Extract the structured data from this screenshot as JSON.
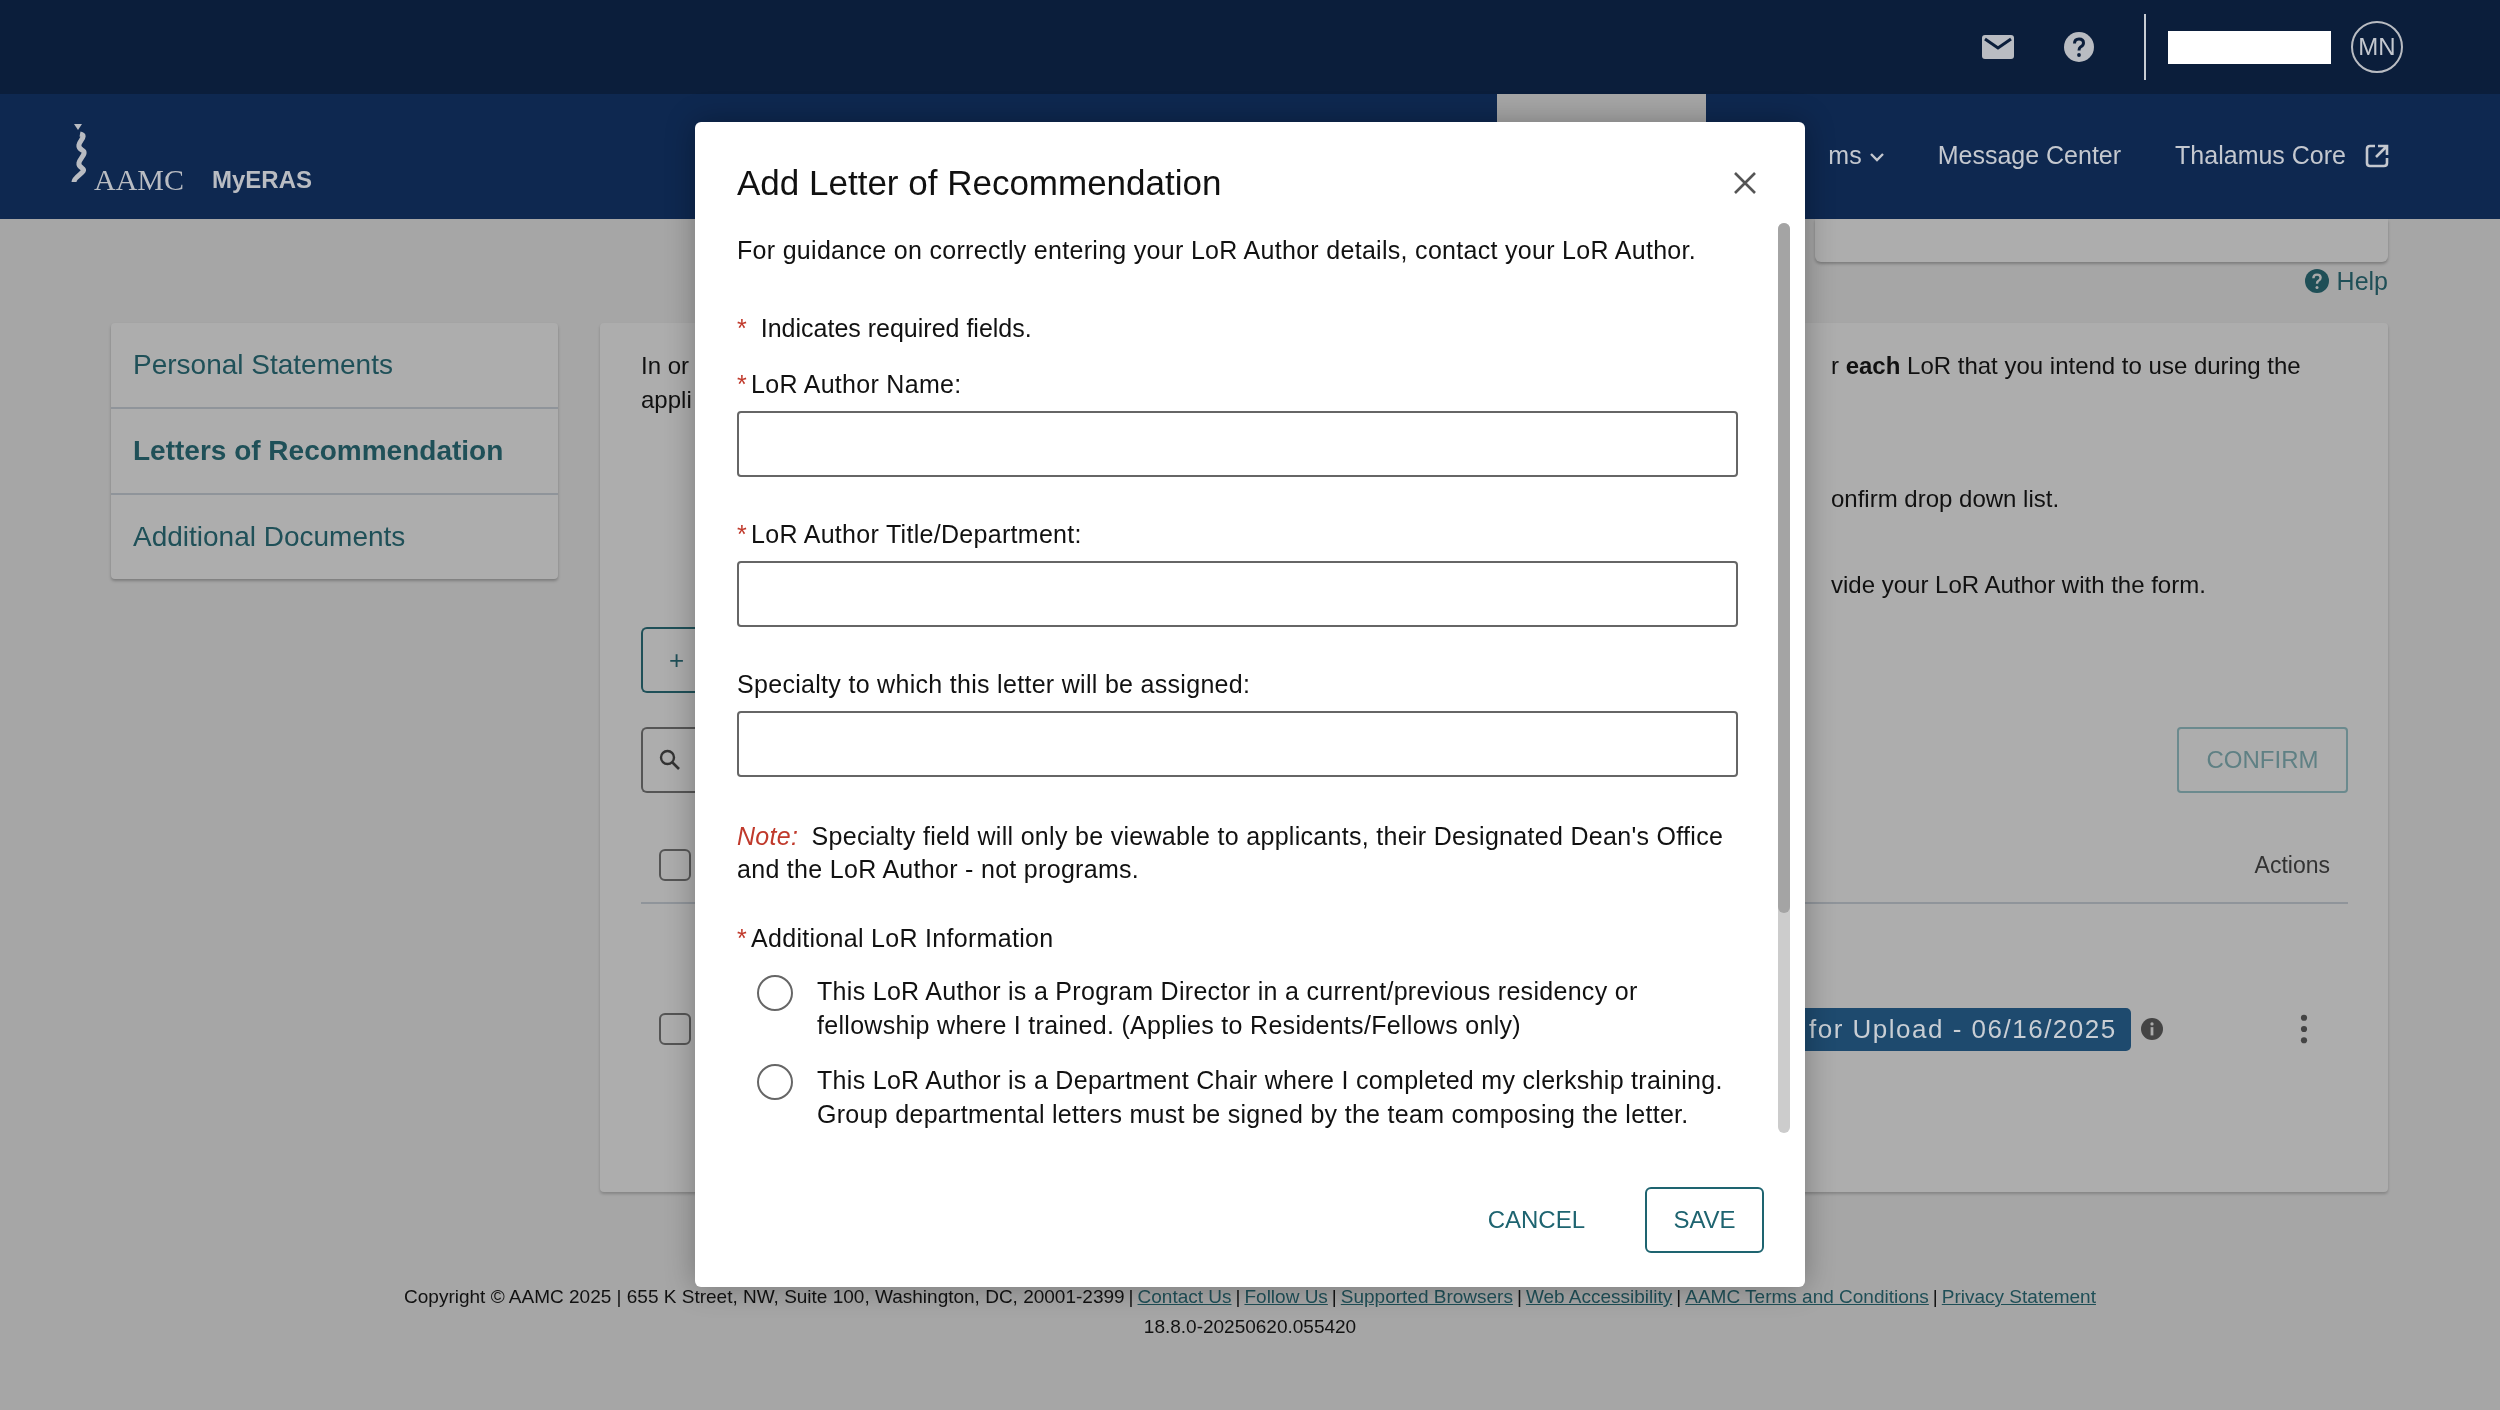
{
  "top_bar": {
    "avatar": "MN"
  },
  "nav": {
    "brand": "AAMC",
    "app": "MyERAS",
    "items": [
      {
        "label": "ms",
        "kind": "dropdown"
      },
      {
        "label": "Message Center",
        "kind": "link"
      },
      {
        "label": "Thalamus Core",
        "kind": "external"
      }
    ]
  },
  "help": "Help",
  "sidebar": {
    "items": [
      {
        "label": "Personal Statements",
        "selected": false
      },
      {
        "label": "Letters of Recommendation",
        "selected": true
      },
      {
        "label": "Additional Documents",
        "selected": false
      }
    ]
  },
  "content": {
    "intro_left": [
      "In or",
      "appli"
    ],
    "intro_right": "r **each** LoR that you intend to use during the",
    "steps": [
      "onfirm drop down list.",
      "vide your LoR Author with the form."
    ],
    "add_button": "+",
    "confirm_button": "CONFIRM",
    "table": {
      "header": "Actions",
      "header_checked": false,
      "rows": [
        {
          "status": "for Upload -  06/16/2025",
          "checked": false
        }
      ]
    }
  },
  "modal": {
    "title": "Add Letter of Recommendation",
    "intro": "For guidance on correctly entering your LoR Author details, contact your LoR Author.",
    "required_mark": "*",
    "required_note": "Indicates required fields.",
    "fields": [
      {
        "label": "LoR Author Name:",
        "required": true
      },
      {
        "label": "LoR Author Title/Department:",
        "required": true
      },
      {
        "label": "Specialty to which this letter will be assigned:",
        "required": false
      }
    ],
    "note_label": "Note:",
    "note": "Specialty field will only be viewable to applicants, their Designated Dean's Office and the LoR Author - not programs.",
    "options_label": "Additional LoR Information",
    "options_required": true,
    "options": [
      {
        "text": "This LoR Author is a Program Director in a current/previous residency or fellowship where I trained. (Applies to Residents/Fellows only)",
        "selected": false
      },
      {
        "text": "This LoR Author is a Department Chair where I completed my clerkship training. Group departmental letters must be signed by the team composing the letter.",
        "selected": false
      }
    ],
    "cancel": "CANCEL",
    "save": "SAVE"
  },
  "footer": {
    "copyright": "Copyright © AAMC 2025 | 655 K Street, NW, Suite 100, Washington, DC, 20001-2399",
    "separator": "|",
    "links": [
      "Contact Us",
      "Follow Us",
      "Supported Browsers",
      "Web Accessibility",
      "AAMC Terms and Conditions",
      "Privacy Statement"
    ],
    "version": "18.8.0-20250620.055420"
  }
}
